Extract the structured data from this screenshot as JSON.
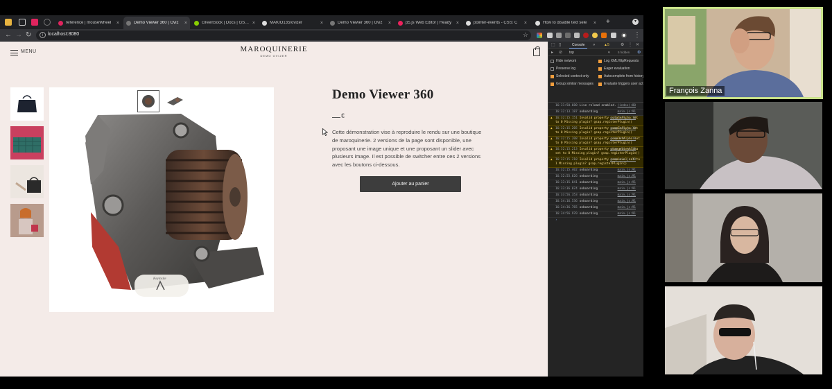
{
  "browser": {
    "tabs": [
      {
        "title": "reference | mouseWheel",
        "favicon_color": "#e0245e",
        "active": false
      },
      {
        "title": "Demo Viewer 360 | Oviz",
        "favicon_color": "#777777",
        "active": true
      },
      {
        "title": "GreenSock | Docs | GSAP",
        "favicon_color": "#88ce02",
        "active": false
      },
      {
        "title": "MAKIO135/ovizer",
        "favicon_color": "#dddddd",
        "active": false
      },
      {
        "title": "Demo Viewer 360 | Oviz",
        "favicon_color": "#777777",
        "active": false
      },
      {
        "title": "p5.js Web Editor | Heady",
        "favicon_color": "#ed225d",
        "active": false
      },
      {
        "title": "pointer-events - CSS: C",
        "favicon_color": "#dddddd",
        "active": false
      },
      {
        "title": "How to disable text sele",
        "favicon_color": "#dddddd",
        "active": false
      }
    ],
    "url": "localhost:8080"
  },
  "site": {
    "menu_label": "MENU",
    "brand_name": "MAROQUINERIE",
    "brand_sub": "DEMO OVIZER"
  },
  "product": {
    "title": "Demo Viewer 360",
    "price_symbol": "€",
    "description": "Cette démonstration vise à reproduire le rendu sur une boutique de maroquinerie. 2 versions de la page sont disponible, une proposant une image unique et une proposant un slider avec plusieurs image. Il est possible de switcher entre ces 2 versions avec les boutons ci-dessous.",
    "cart_button": "Ajouter au panier",
    "viewer_badge": "Keyinsite"
  },
  "devtools": {
    "tab_console": "Console",
    "warnings": "▲5",
    "context": "top",
    "hidden": "5 hidden",
    "settings_left": [
      {
        "label": "Hide network",
        "checked": false
      },
      {
        "label": "Preserve log",
        "checked": false
      },
      {
        "label": "Selected context only",
        "checked": true
      },
      {
        "label": "Group similar messages",
        "checked": true
      }
    ],
    "settings_right": [
      {
        "label": "Log XMLHttpRequests",
        "checked": true
      },
      {
        "label": "Eager evaluation",
        "checked": true
      },
      {
        "label": "Autocomplete from history",
        "checked": true
      },
      {
        "label": "Evaluate triggers user activation",
        "checked": true
      }
    ],
    "log": [
      {
        "level": "info",
        "time": "16:31:50.680",
        "text": "Live reload enabled.",
        "source": "(index):80"
      },
      {
        "level": "info",
        "time": "16:32:13.187",
        "text": "onboarding",
        "source": "main.js:91"
      },
      {
        "level": "warn",
        "time": "16:32:15.151",
        "text": "Invalid property rotateAlpha set to 0 Missing plugin? gsap.registerPlugin()",
        "source": "gsap.min.js:10"
      },
      {
        "level": "warn",
        "time": "16:32:15.205",
        "text": "Invalid property zoomInAlpha set to 0 Missing plugin? gsap.registerPlugin()",
        "source": "gsap.min.js:10"
      },
      {
        "level": "warn",
        "time": "16:32:15.208",
        "text": "Invalid property zoomOutAlpha set to 0 Missing plugin? gsap.registerPlugin()",
        "source": "gsap.min.js:10"
      },
      {
        "level": "warn",
        "time": "16:32:15.213",
        "text": "Invalid property changeViewAlpha set to 0 Missing plugin? gsap.registerPlugin()",
        "source": "gsap.min.js:10"
      },
      {
        "level": "warn",
        "time": "16:32:15.218",
        "text": "Invalid property zoomLevel set to 1 Missing plugin? gsap.registerPlugin()",
        "source": "gsap.min.js:10"
      },
      {
        "level": "info",
        "time": "16:32:15.402",
        "text": "onboarding",
        "source": "main.js:91"
      },
      {
        "level": "info",
        "time": "16:32:55.626",
        "text": "onboarding",
        "source": "main.js:91"
      },
      {
        "level": "info",
        "time": "16:33:15.841",
        "text": "onboarding",
        "source": "main.js:91"
      },
      {
        "level": "info",
        "time": "16:33:36.074",
        "text": "onboarding",
        "source": "main.js:91"
      },
      {
        "level": "info",
        "time": "16:33:56.353",
        "text": "onboarding",
        "source": "main.js:91"
      },
      {
        "level": "info",
        "time": "16:34:16.536",
        "text": "onboarding",
        "source": "main.js:91"
      },
      {
        "level": "info",
        "time": "16:34:36.765",
        "text": "onboarding",
        "source": "main.js:91"
      },
      {
        "level": "info",
        "time": "16:34:56.970",
        "text": "onboarding",
        "source": "main.js:91"
      }
    ]
  },
  "call": {
    "speaker_name": "François Zanna",
    "speaker_highlight": "#c9e28b"
  }
}
